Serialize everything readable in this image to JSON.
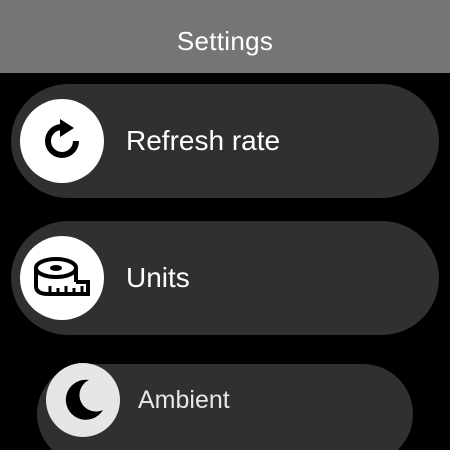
{
  "header": {
    "title": "Settings"
  },
  "settings_items": [
    {
      "label": "Refresh rate",
      "icon": "refresh-icon"
    },
    {
      "label": "Units",
      "icon": "measuring-tape-icon"
    },
    {
      "label": "Ambient",
      "icon": "moon-icon"
    }
  ],
  "colors": {
    "background": "#000000",
    "header": "#757575",
    "item_background": "#303030",
    "icon_circle": "#ffffff",
    "text": "#ffffff"
  }
}
